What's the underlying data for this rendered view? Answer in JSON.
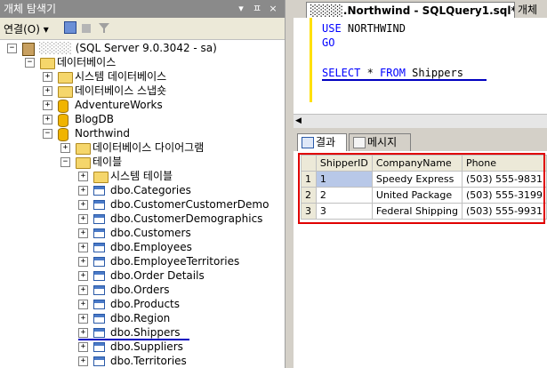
{
  "explorer": {
    "title": "개체 탐색기",
    "pin_icons": [
      "▾",
      "ㅍ",
      "×"
    ],
    "connect_label": "연결(O)",
    "connect_arrow": "▾"
  },
  "tree": [
    {
      "label": "(SQL Server 9.0.3042 - sa)",
      "prefix": "░░░░",
      "icon": "server-icon",
      "exp": "−",
      "indent": 0
    },
    {
      "label": "데이터베이스",
      "icon": "folder-icon",
      "exp": "−",
      "indent": 1
    },
    {
      "label": "시스템 데이터베이스",
      "icon": "folder-icon",
      "exp": "+",
      "indent": 2
    },
    {
      "label": "데이터베이스 스냅숏",
      "icon": "folder-icon",
      "exp": "+",
      "indent": 2
    },
    {
      "label": "AdventureWorks",
      "icon": "database-icon",
      "exp": "+",
      "indent": 2
    },
    {
      "label": "BlogDB",
      "icon": "database-icon",
      "exp": "+",
      "indent": 2
    },
    {
      "label": "Northwind",
      "icon": "database-icon",
      "exp": "−",
      "indent": 2
    },
    {
      "label": "데이터베이스 다이어그램",
      "icon": "folder-icon",
      "exp": "+",
      "indent": 3
    },
    {
      "label": "테이블",
      "icon": "folder-icon",
      "exp": "−",
      "indent": 3
    },
    {
      "label": "시스템 테이블",
      "icon": "folder-icon",
      "exp": "+",
      "indent": 4
    },
    {
      "label": "dbo.Categories",
      "icon": "table-icon",
      "exp": "+",
      "indent": 4
    },
    {
      "label": "dbo.CustomerCustomerDemo",
      "icon": "table-icon",
      "exp": "+",
      "indent": 4
    },
    {
      "label": "dbo.CustomerDemographics",
      "icon": "table-icon",
      "exp": "+",
      "indent": 4
    },
    {
      "label": "dbo.Customers",
      "icon": "table-icon",
      "exp": "+",
      "indent": 4
    },
    {
      "label": "dbo.Employees",
      "icon": "table-icon",
      "exp": "+",
      "indent": 4
    },
    {
      "label": "dbo.EmployeeTerritories",
      "icon": "table-icon",
      "exp": "+",
      "indent": 4
    },
    {
      "label": "dbo.Order Details",
      "icon": "table-icon",
      "exp": "+",
      "indent": 4
    },
    {
      "label": "dbo.Orders",
      "icon": "table-icon",
      "exp": "+",
      "indent": 4
    },
    {
      "label": "dbo.Products",
      "icon": "table-icon",
      "exp": "+",
      "indent": 4
    },
    {
      "label": "dbo.Region",
      "icon": "table-icon",
      "exp": "+",
      "indent": 4
    },
    {
      "label": "dbo.Shippers",
      "icon": "table-icon",
      "exp": "+",
      "indent": 4,
      "underlined": true
    },
    {
      "label": "dbo.Suppliers",
      "icon": "table-icon",
      "exp": "+",
      "indent": 4
    },
    {
      "label": "dbo.Territories",
      "icon": "table-icon",
      "exp": "+",
      "indent": 4
    }
  ],
  "editor": {
    "tab_title": "░░░░.Northwind - SQLQuery1.sql*",
    "other_tab": "개체",
    "lines": [
      {
        "kw": "USE",
        "rest": " NORTHWIND"
      },
      {
        "kw": "GO",
        "rest": ""
      },
      {
        "kw": "",
        "rest": ""
      },
      {
        "kw": "SELECT",
        "rest": " * ",
        "kw2": "FROM",
        "rest2": " Shippers"
      }
    ]
  },
  "results": {
    "tab_results": "결과",
    "tab_messages": "메시지",
    "columns": [
      "ShipperID",
      "CompanyName",
      "Phone"
    ],
    "rows": [
      {
        "num": "1",
        "cells": [
          "1",
          "Speedy Express",
          "(503) 555-9831"
        ]
      },
      {
        "num": "2",
        "cells": [
          "2",
          "United Package",
          "(503) 555-3199"
        ]
      },
      {
        "num": "3",
        "cells": [
          "3",
          "Federal Shipping",
          "(503) 555-9931"
        ]
      }
    ]
  },
  "colors": {
    "highlight_red": "#e00000",
    "underline_blue": "#0000c0",
    "keyword_blue": "#0000ff"
  }
}
